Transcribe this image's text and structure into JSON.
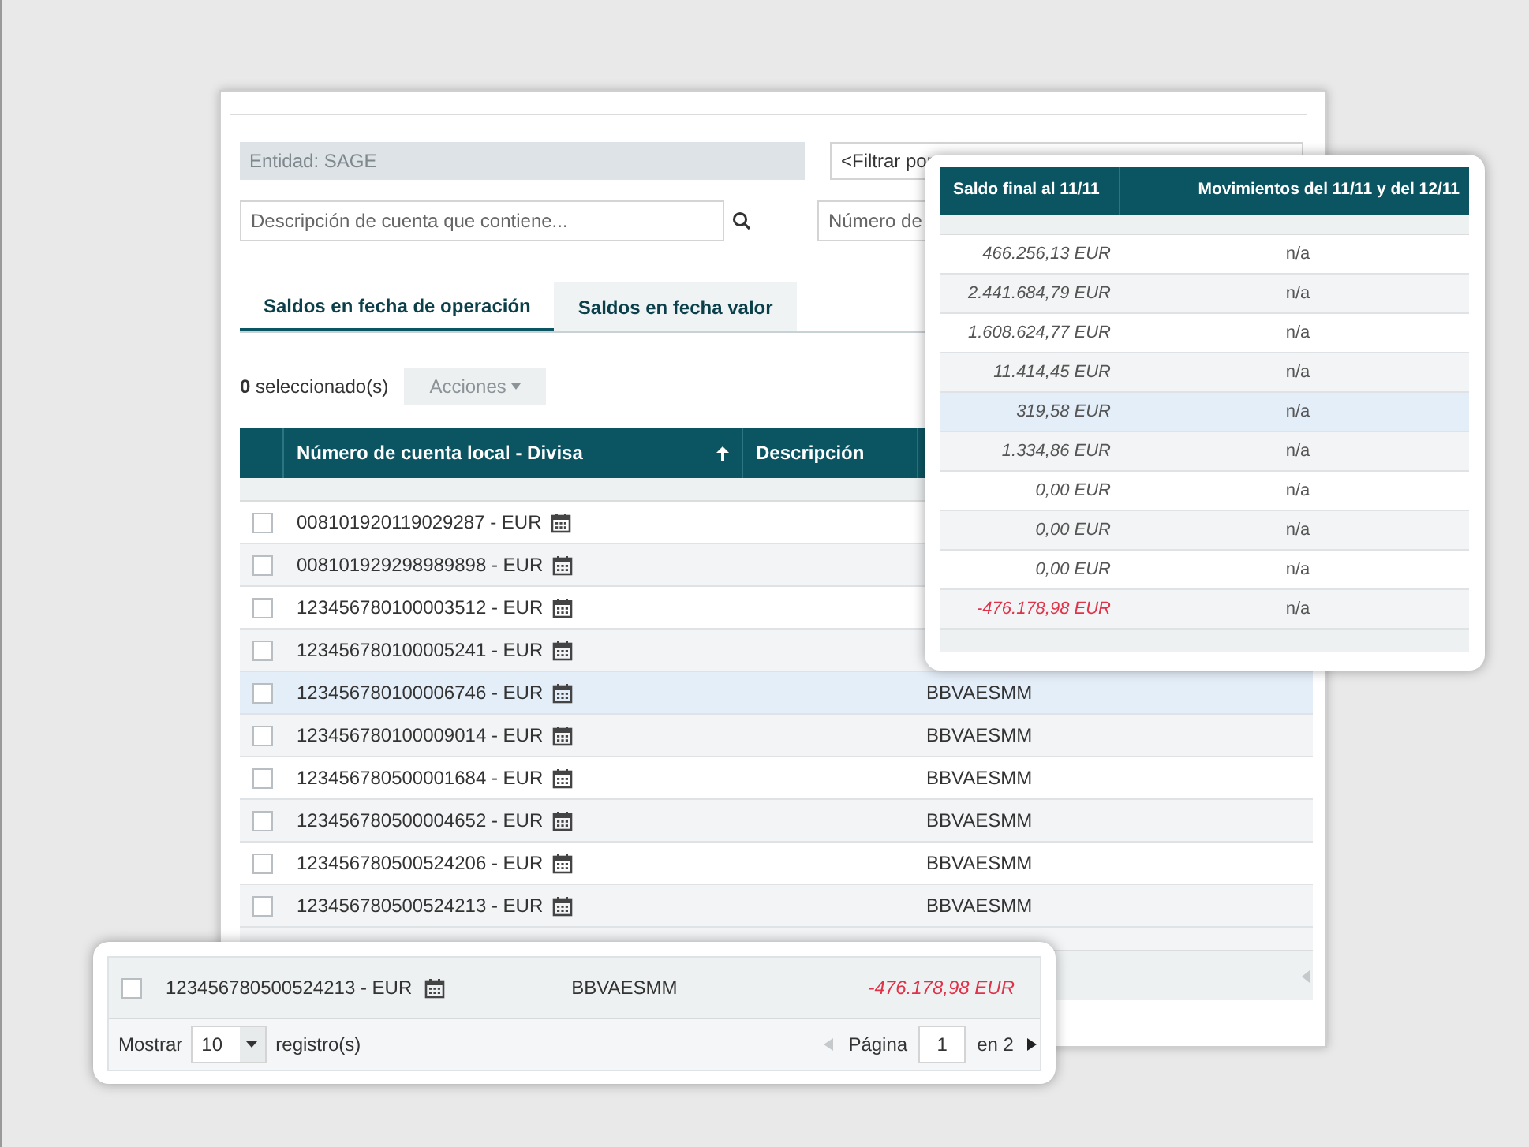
{
  "filters": {
    "entity": {
      "value": "Entidad: SAGE",
      "disabled": true
    },
    "bic_filter": {
      "value": "<Filtrar por"
    },
    "description_search": {
      "placeholder": "Descripción de cuenta que contiene..."
    },
    "account_number": {
      "placeholder": "Número de"
    }
  },
  "tabs": [
    {
      "label": "Saldos en fecha de operación",
      "selected": true
    },
    {
      "label": "Saldos en fecha valor",
      "selected": false
    }
  ],
  "selection": {
    "count_text": "**0** seleccionado(s)",
    "actions_button": {
      "label": "Acciones",
      "disabled": true
    }
  },
  "table": {
    "columns": [
      {
        "label": "Número de cuenta local - Divisa",
        "sorted": true
      },
      {
        "label": "Descripción",
        "sorted": false
      }
    ],
    "rows": [
      {
        "account": "008101920119029287 - EUR",
        "checked": false,
        "highlighted": false
      },
      {
        "account": "008101929298989898 - EUR",
        "checked": false,
        "highlighted": false
      },
      {
        "account": "123456780100003512 - EUR",
        "checked": false,
        "highlighted": false
      },
      {
        "account": "123456780100005241 - EUR",
        "checked": false,
        "highlighted": false
      },
      {
        "account": "123456780100006746 - EUR",
        "bic": "BBVAESMM",
        "checked": false,
        "highlighted": true
      },
      {
        "account": "123456780100009014 - EUR",
        "bic": "BBVAESMM",
        "checked": false,
        "highlighted": false
      },
      {
        "account": "123456780500001684 - EUR",
        "bic": "BBVAESMM",
        "checked": false,
        "highlighted": false
      },
      {
        "account": "123456780500004652 - EUR",
        "bic": "BBVAESMM",
        "checked": false,
        "highlighted": false
      },
      {
        "account": "123456780500524206 - EUR",
        "bic": "BBVAESMM",
        "checked": false,
        "highlighted": false
      },
      {
        "account": "123456780500524213 - EUR",
        "bic": "BBVAESMM",
        "checked": false,
        "highlighted": false
      }
    ]
  },
  "balances_popup": {
    "columns": [
      "Saldo final al 11/11",
      "Movimientos del 11/11 y del 12/11"
    ],
    "rows": [
      {
        "balance": "466.256,13 EUR",
        "movements": "n/a",
        "negative": false,
        "highlighted": false
      },
      {
        "balance": "2.441.684,79 EUR",
        "movements": "n/a",
        "negative": false,
        "highlighted": false
      },
      {
        "balance": "1.608.624,77 EUR",
        "movements": "n/a",
        "negative": false,
        "highlighted": false
      },
      {
        "balance": "11.414,45 EUR",
        "movements": "n/a",
        "negative": false,
        "highlighted": false
      },
      {
        "balance": "319,58 EUR",
        "movements": "n/a",
        "negative": false,
        "highlighted": true
      },
      {
        "balance": "1.334,86 EUR",
        "movements": "n/a",
        "negative": false,
        "highlighted": false
      },
      {
        "balance": "0,00 EUR",
        "movements": "n/a",
        "negative": false,
        "highlighted": false
      },
      {
        "balance": "0,00 EUR",
        "movements": "n/a",
        "negative": false,
        "highlighted": false
      },
      {
        "balance": "0,00 EUR",
        "movements": "n/a",
        "negative": false,
        "highlighted": false
      },
      {
        "balance": "-476.178,98 EUR",
        "movements": "n/a",
        "negative": true,
        "highlighted": false
      }
    ]
  },
  "detail_popup": {
    "row": {
      "account": "123456780500524213 - EUR",
      "bic": "BBVAESMM",
      "balance": "-476.178,98 EUR",
      "negative": true,
      "checked": false
    },
    "pagination": {
      "show_label": "Mostrar",
      "page_size": "10",
      "records_label": "registro(s)",
      "page_label": "Página",
      "page": "1",
      "of_label": "en 2"
    }
  }
}
